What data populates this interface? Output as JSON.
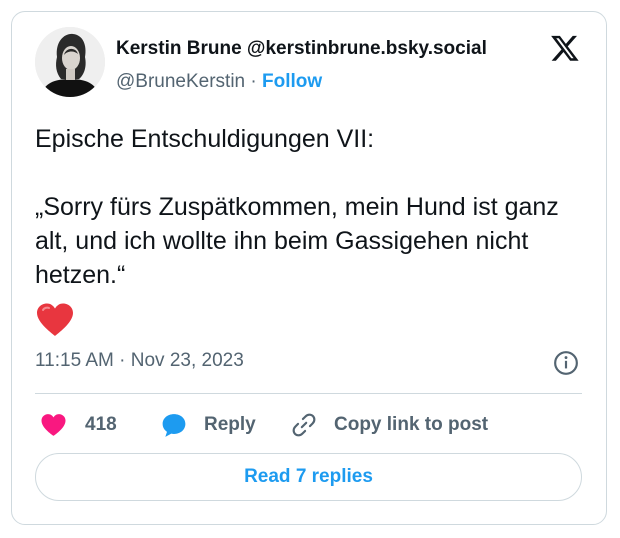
{
  "author": {
    "name_line": "Kerstin Brune @kerstinbrune.bsky.social",
    "handle": "@BruneKerstin",
    "separator": "·",
    "follow_label": "Follow"
  },
  "post": {
    "line1": "Epische Entschuldigungen VII:",
    "quote": "„Sorry fürs Zuspätkommen, mein Hund ist ganz alt, und ich wollte ihn beim Gassigehen nicht hetzen.“",
    "emoji_icon": "red-heart-icon",
    "timestamp": "11:15 AM · Nov 23, 2023"
  },
  "actions": {
    "likes_count": "418",
    "reply_label": "Reply",
    "copy_label": "Copy link to post"
  },
  "read_replies_label": "Read 7 replies",
  "colors": {
    "accent": "#1d9bf0",
    "like": "#f91880",
    "text": "#0f1419",
    "muted": "#536471",
    "border": "#cfd9de",
    "emoji_heart": "#e8363f"
  }
}
